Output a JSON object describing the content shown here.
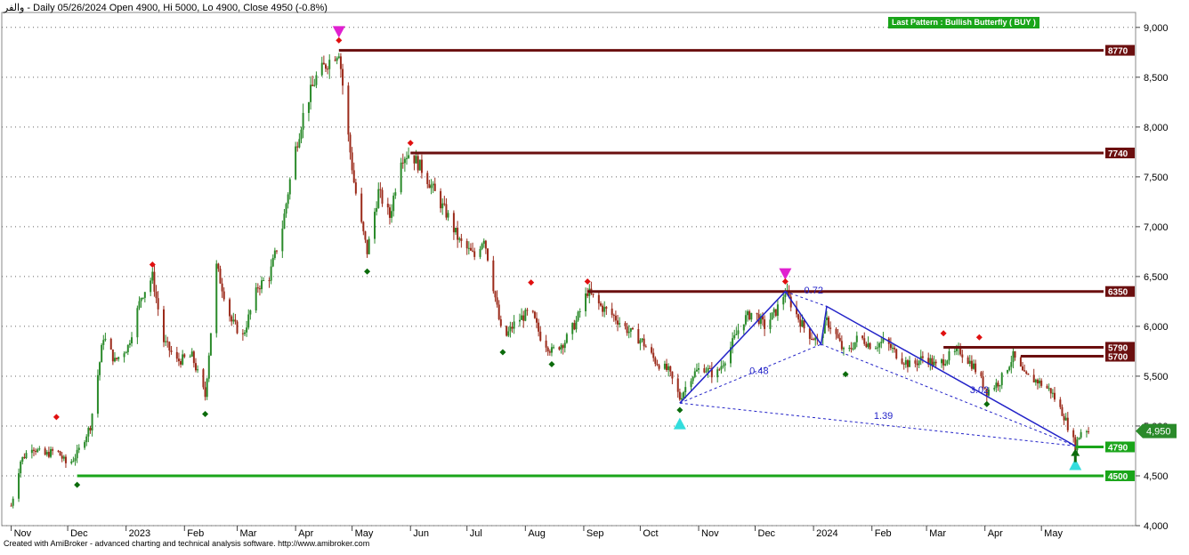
{
  "header": {
    "title": "والفر - Daily 05/26/2024 Open 4900, Hi 5000, Lo 4900, Close 4950 (-0.8%)"
  },
  "pattern_label": "Last Pattern : Bullish Butterfly ( BUY )",
  "footer": "Created with AmiBroker - advanced charting and technical analysis software. http://www.amibroker.com",
  "colors": {
    "up": "#2a8a2a",
    "down": "#9b2a1a",
    "resistance": "#6b0f0f",
    "support": "#1aa51a",
    "pattern": "#2323c8",
    "marker_magenta": "#e020d0",
    "marker_cyan": "#33dddd",
    "diamond_red": "#e01010",
    "diamond_green": "#0b6b0b"
  },
  "chart_data": {
    "type": "candlestick",
    "ylim": [
      4000,
      9150
    ],
    "y_ticks": [
      "4,000",
      "4,500",
      "5,000",
      "5,500",
      "6,000",
      "6,500",
      "7,000",
      "7,500",
      "8,000",
      "8,500",
      "9,000"
    ],
    "x_labels": [
      "Nov",
      "Dec",
      "2023",
      "Feb",
      "Mar",
      "Apr",
      "May",
      "Jun",
      "Jul",
      "Aug",
      "Sep",
      "Oct",
      "Nov",
      "Dec",
      "2024",
      "Feb",
      "Mar",
      "Apr",
      "May"
    ],
    "last_close_label": "4,950",
    "price_path": [
      [
        "2022-11-01",
        4200
      ],
      [
        "2022-11-06",
        4650
      ],
      [
        "2022-11-12",
        4800
      ],
      [
        "2022-11-18",
        4700
      ],
      [
        "2022-11-25",
        4760
      ],
      [
        "2022-12-01",
        4600
      ],
      [
        "2022-12-06",
        4720
      ],
      [
        "2022-12-13",
        5000
      ],
      [
        "2022-12-20",
        5900
      ],
      [
        "2022-12-26",
        5650
      ],
      [
        "2023-01-02",
        5800
      ],
      [
        "2023-01-09",
        6300
      ],
      [
        "2023-01-15",
        6500
      ],
      [
        "2023-01-21",
        5850
      ],
      [
        "2023-01-28",
        5650
      ],
      [
        "2023-02-05",
        5700
      ],
      [
        "2023-02-12",
        5300
      ],
      [
        "2023-02-18",
        6600
      ],
      [
        "2023-02-26",
        6050
      ],
      [
        "2023-03-04",
        5900
      ],
      [
        "2023-03-12",
        6400
      ],
      [
        "2023-03-18",
        6500
      ],
      [
        "2023-03-25",
        7000
      ],
      [
        "2023-03-31",
        7700
      ],
      [
        "2023-04-06",
        8200
      ],
      [
        "2023-04-12",
        8500
      ],
      [
        "2023-04-18",
        8650
      ],
      [
        "2023-04-24",
        8770
      ],
      [
        "2023-04-29",
        7900
      ],
      [
        "2023-05-02",
        7450
      ],
      [
        "2023-05-05",
        7100
      ],
      [
        "2023-05-09",
        6750
      ],
      [
        "2023-05-15",
        7350
      ],
      [
        "2023-05-21",
        7100
      ],
      [
        "2023-05-27",
        7700
      ],
      [
        "2023-06-01",
        7740
      ],
      [
        "2023-06-08",
        7550
      ],
      [
        "2023-06-15",
        7300
      ],
      [
        "2023-06-21",
        7100
      ],
      [
        "2023-06-27",
        6850
      ],
      [
        "2023-07-05",
        6700
      ],
      [
        "2023-07-10",
        6900
      ],
      [
        "2023-07-15",
        6400
      ],
      [
        "2023-07-20",
        5850
      ],
      [
        "2023-07-27",
        6050
      ],
      [
        "2023-08-04",
        6150
      ],
      [
        "2023-08-09",
        5900
      ],
      [
        "2023-08-15",
        5750
      ],
      [
        "2023-08-22",
        5850
      ],
      [
        "2023-08-28",
        6050
      ],
      [
        "2023-09-03",
        6350
      ],
      [
        "2023-09-10",
        6200
      ],
      [
        "2023-09-17",
        6100
      ],
      [
        "2023-09-25",
        5950
      ],
      [
        "2023-10-02",
        5850
      ],
      [
        "2023-10-09",
        5650
      ],
      [
        "2023-10-16",
        5550
      ],
      [
        "2023-10-22",
        5280
      ],
      [
        "2023-10-28",
        5500
      ],
      [
        "2023-11-03",
        5600
      ],
      [
        "2023-11-10",
        5500
      ],
      [
        "2023-11-17",
        5750
      ],
      [
        "2023-11-24",
        6050
      ],
      [
        "2023-11-30",
        6150
      ],
      [
        "2023-12-06",
        6000
      ],
      [
        "2023-12-12",
        6150
      ],
      [
        "2023-12-17",
        6350
      ],
      [
        "2023-12-22",
        6150
      ],
      [
        "2023-12-28",
        5950
      ],
      [
        "2024-01-03",
        5850
      ],
      [
        "2024-01-08",
        6050
      ],
      [
        "2024-01-12",
        5950
      ],
      [
        "2024-01-18",
        5700
      ],
      [
        "2024-01-25",
        5900
      ],
      [
        "2024-02-01",
        5800
      ],
      [
        "2024-02-08",
        5850
      ],
      [
        "2024-02-15",
        5700
      ],
      [
        "2024-02-22",
        5600
      ],
      [
        "2024-02-29",
        5700
      ],
      [
        "2024-03-06",
        5600
      ],
      [
        "2024-03-13",
        5700
      ],
      [
        "2024-03-19",
        5750
      ],
      [
        "2024-03-26",
        5600
      ],
      [
        "2024-04-02",
        5350
      ],
      [
        "2024-04-09",
        5450
      ],
      [
        "2024-04-16",
        5700
      ],
      [
        "2024-04-22",
        5500
      ],
      [
        "2024-04-29",
        5450
      ],
      [
        "2024-05-06",
        5350
      ],
      [
        "2024-05-13",
        5100
      ],
      [
        "2024-05-19",
        4800
      ],
      [
        "2024-05-23",
        5000
      ],
      [
        "2024-05-26",
        4950
      ]
    ],
    "resistance_levels": [
      {
        "label": "8770",
        "value": 8770,
        "from": "2023-04-24"
      },
      {
        "label": "7740",
        "value": 7740,
        "from": "2023-06-01"
      },
      {
        "label": "6350",
        "value": 6350,
        "from": "2023-09-03"
      },
      {
        "label": "5790",
        "value": 5790,
        "from": "2024-03-10"
      },
      {
        "label": "5700",
        "value": 5700,
        "from": "2024-04-20"
      }
    ],
    "support_levels": [
      {
        "label": "4790",
        "value": 4790,
        "from": "2024-05-19"
      },
      {
        "label": "4500",
        "value": 4500,
        "from": "2022-12-06"
      }
    ],
    "butterfly": {
      "points": [
        [
          "2023-10-22",
          5230
        ],
        [
          "2023-12-17",
          6350
        ],
        [
          "2024-01-05",
          5820
        ],
        [
          "2024-01-08",
          6200
        ],
        [
          "2024-05-19",
          4800
        ]
      ],
      "ratios": [
        {
          "label": "0.48",
          "x": "2023-11-28",
          "y": 5520
        },
        {
          "label": "0.72",
          "x": "2023-12-27",
          "y": 6330
        },
        {
          "label": "3.02",
          "x": "2024-03-24",
          "y": 5330
        },
        {
          "label": "1.39",
          "x": "2024-02-02",
          "y": 5070
        }
      ]
    },
    "markers": [
      {
        "kind": "triangle-down",
        "color": "magenta",
        "x": "2023-04-24",
        "y": 8950
      },
      {
        "kind": "triangle-down",
        "color": "magenta",
        "x": "2023-12-17",
        "y": 6520
      },
      {
        "kind": "triangle-up",
        "color": "cyan",
        "x": "2023-10-22",
        "y": 5030
      },
      {
        "kind": "triangle-up",
        "color": "cyan",
        "x": "2024-05-19",
        "y": 4620
      },
      {
        "kind": "arrow-up",
        "color": "green",
        "x": "2024-05-19",
        "y": 4700
      },
      {
        "kind": "diamond",
        "color": "red",
        "x": "2022-11-25",
        "y": 5090
      },
      {
        "kind": "diamond",
        "color": "red",
        "x": "2023-01-15",
        "y": 6620
      },
      {
        "kind": "diamond",
        "color": "red",
        "x": "2023-04-24",
        "y": 8870
      },
      {
        "kind": "diamond",
        "color": "red",
        "x": "2023-06-01",
        "y": 7840
      },
      {
        "kind": "diamond",
        "color": "red",
        "x": "2023-08-04",
        "y": 6440
      },
      {
        "kind": "diamond",
        "color": "red",
        "x": "2023-09-03",
        "y": 6450
      },
      {
        "kind": "diamond",
        "color": "red",
        "x": "2023-12-17",
        "y": 6450
      },
      {
        "kind": "diamond",
        "color": "red",
        "x": "2024-03-10",
        "y": 5930
      },
      {
        "kind": "diamond",
        "color": "red",
        "x": "2024-03-29",
        "y": 5890
      },
      {
        "kind": "diamond",
        "color": "green",
        "x": "2022-12-06",
        "y": 4410
      },
      {
        "kind": "diamond",
        "color": "green",
        "x": "2023-02-12",
        "y": 5120
      },
      {
        "kind": "diamond",
        "color": "green",
        "x": "2023-05-09",
        "y": 6550
      },
      {
        "kind": "diamond",
        "color": "green",
        "x": "2023-07-20",
        "y": 5740
      },
      {
        "kind": "diamond",
        "color": "green",
        "x": "2023-08-15",
        "y": 5620
      },
      {
        "kind": "diamond",
        "color": "green",
        "x": "2023-10-22",
        "y": 5160
      },
      {
        "kind": "diamond",
        "color": "green",
        "x": "2024-01-18",
        "y": 5520
      },
      {
        "kind": "diamond",
        "color": "green",
        "x": "2024-04-02",
        "y": 5220
      }
    ]
  }
}
